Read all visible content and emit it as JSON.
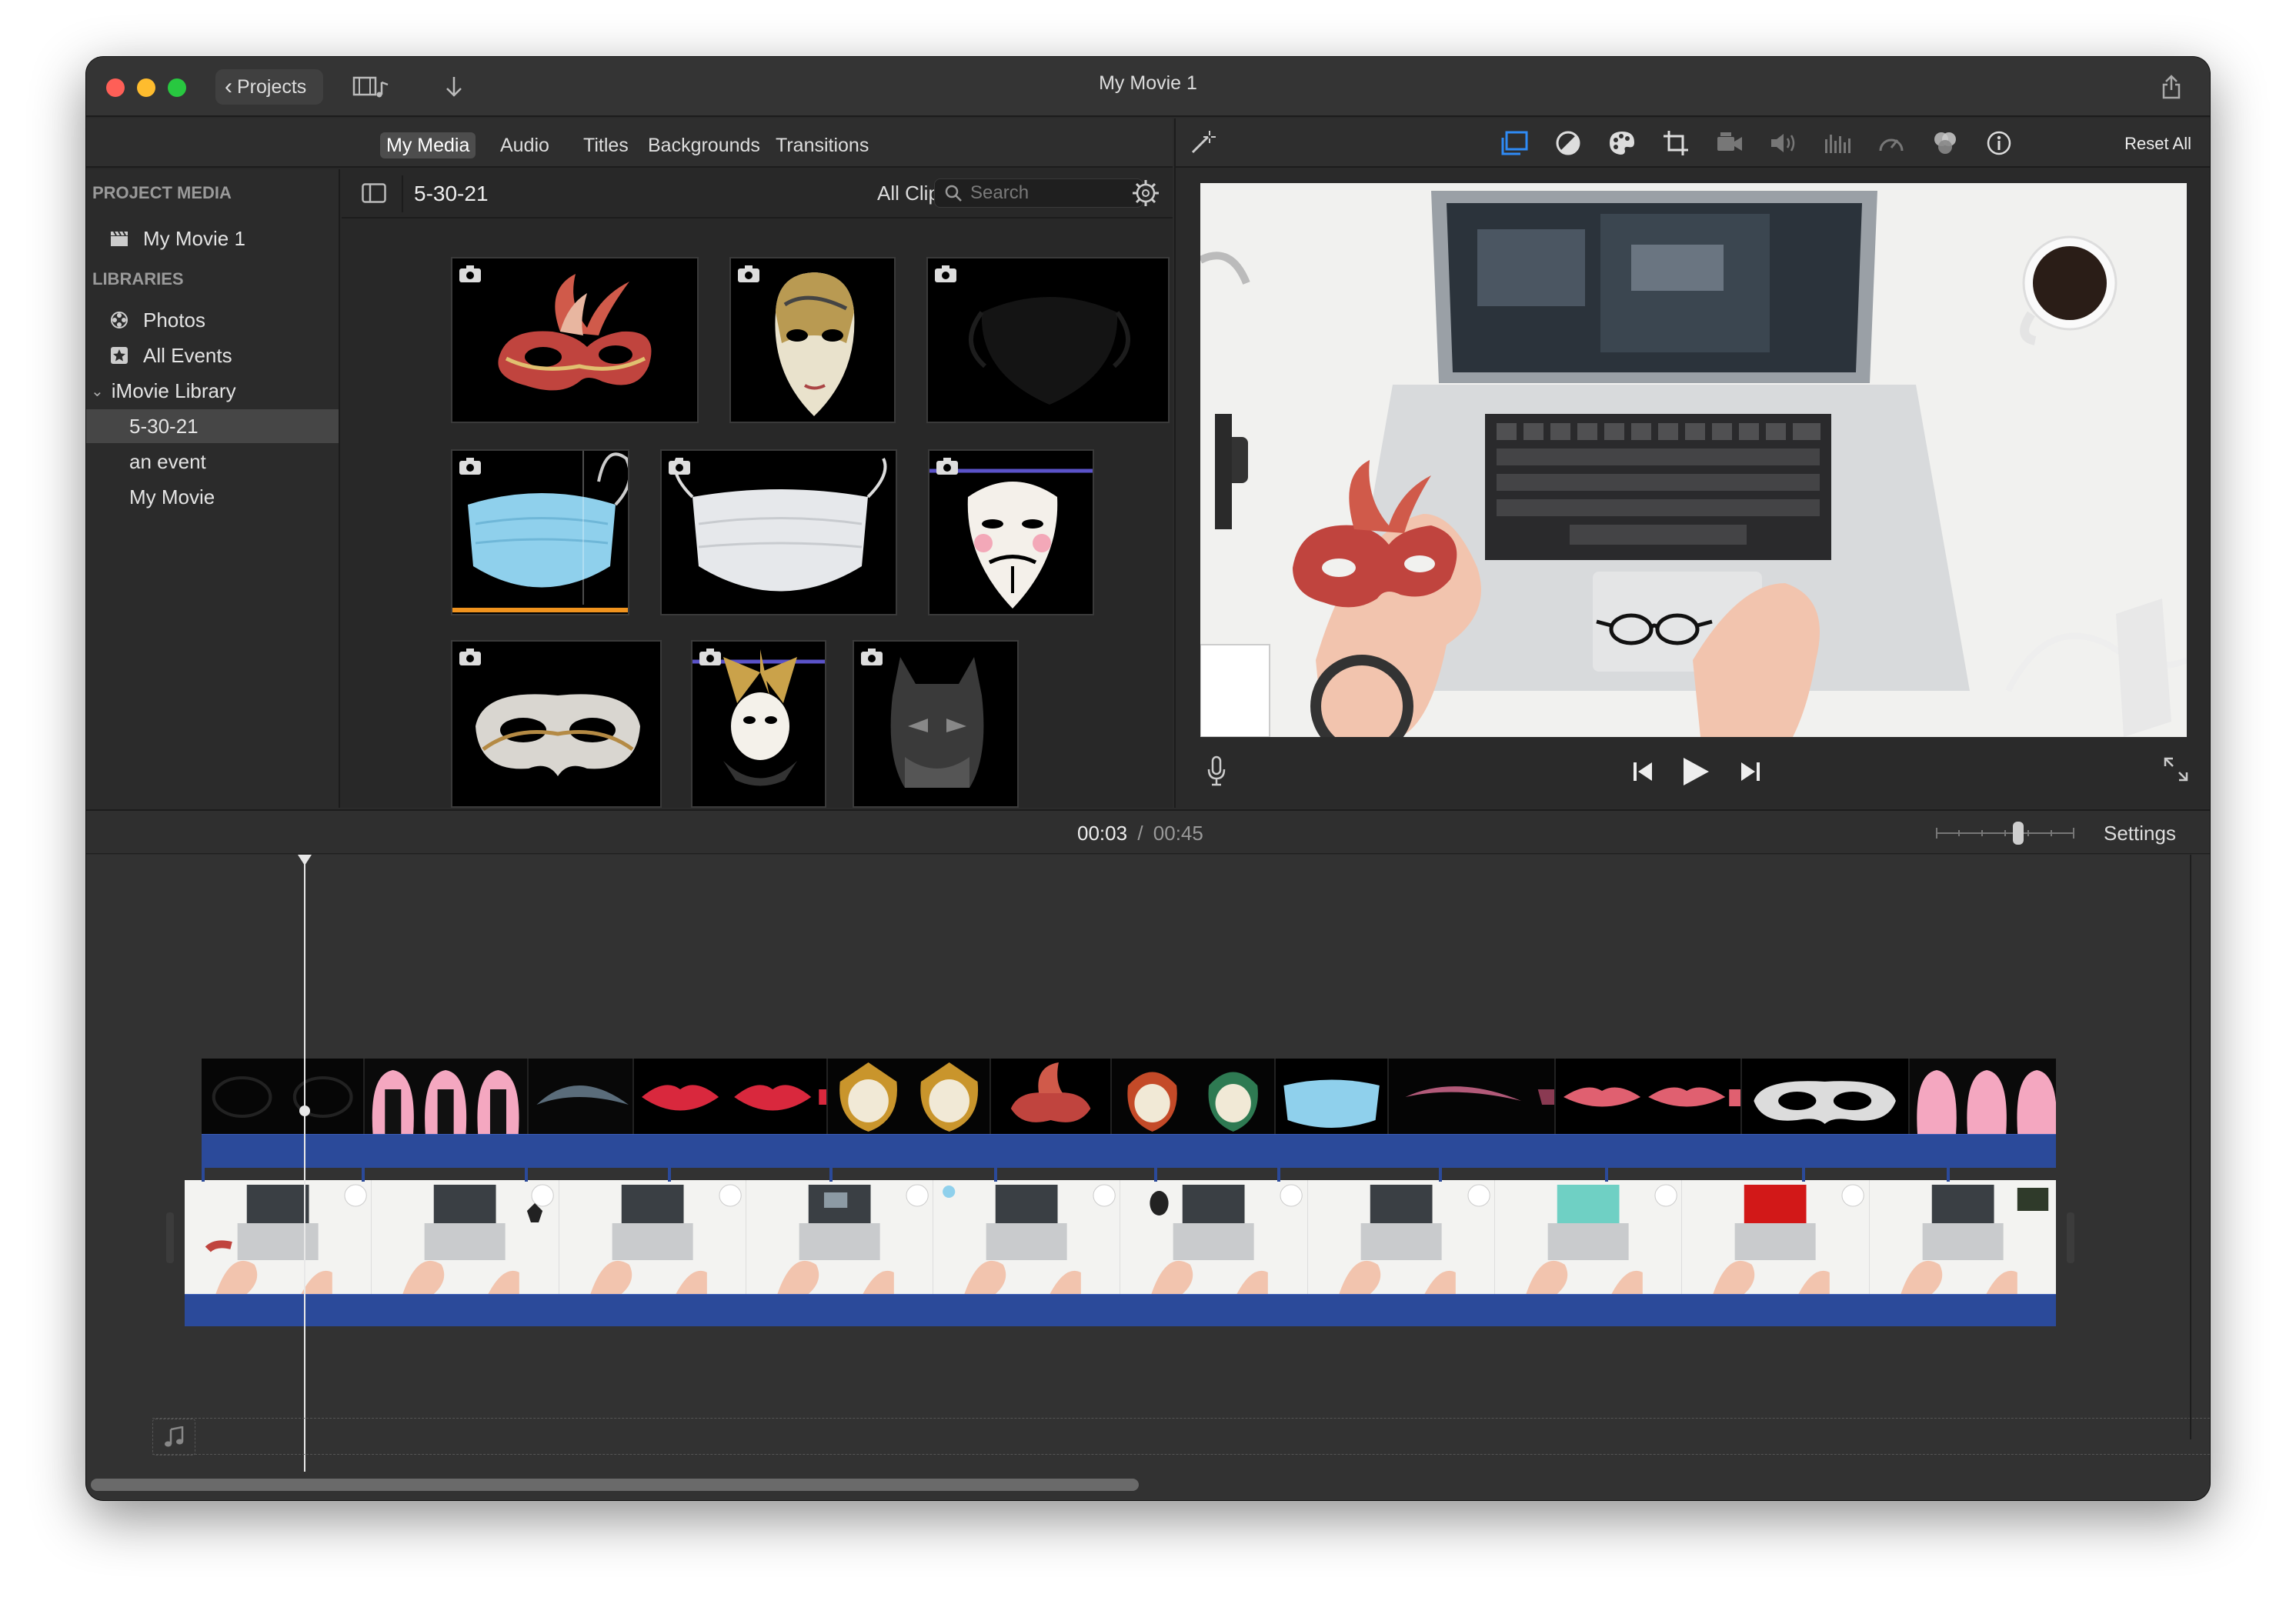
{
  "window": {
    "title": "My Movie 1"
  },
  "toolbar": {
    "projects_label": "Projects"
  },
  "tabs": [
    {
      "label": "My Media",
      "selected": true
    },
    {
      "label": "Audio"
    },
    {
      "label": "Titles"
    },
    {
      "label": "Backgrounds"
    },
    {
      "label": "Transitions"
    }
  ],
  "sidebar": {
    "project_media_header": "PROJECT MEDIA",
    "project_item": "My Movie 1",
    "libraries_header": "LIBRARIES",
    "photos": "Photos",
    "all_events": "All Events",
    "library": "iMovie Library",
    "events": [
      "5-30-21",
      "an event",
      "My Movie"
    ],
    "selected_event": "5-30-21"
  },
  "browser": {
    "event_title": "5-30-21",
    "filter": "All Clips",
    "search_placeholder": "Search",
    "clips": [
      "venetian-mask-red",
      "venetian-mask-face",
      "black-face-mask",
      "blue-surgical-mask",
      "white-surgical-mask",
      "guy-fawkes-mask",
      "silver-masquerade-mask",
      "jester-mask",
      "batman-mask"
    ]
  },
  "viewer": {
    "reset_all": "Reset All"
  },
  "timeline": {
    "current_time": "00:03",
    "separator": "/",
    "total_time": "00:45",
    "settings": "Settings",
    "zoom_level": 0.6,
    "scroll_fraction": 0.47
  },
  "colors": {
    "accent_blue": "#2b4a9a",
    "window_bg": "#2b2b2b",
    "selected_tab": "#4d4d4d"
  },
  "icons": [
    "magic-wand-icon",
    "color-balance-icon",
    "color-correction-icon",
    "crop-icon",
    "stabilization-icon",
    "volume-icon",
    "noise-reduction-icon",
    "speed-icon",
    "filter-icon",
    "info-icon",
    "microphone-icon",
    "skip-back-icon",
    "play-icon",
    "skip-forward-icon",
    "fullscreen-icon",
    "share-icon",
    "music-note-icon"
  ]
}
